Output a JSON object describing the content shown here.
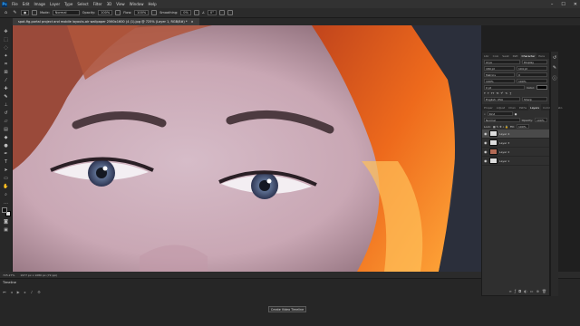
{
  "app": {
    "logo": "Ps"
  },
  "menu": [
    "File",
    "Edit",
    "Image",
    "Layer",
    "Type",
    "Select",
    "Filter",
    "3D",
    "View",
    "Window",
    "Help"
  ],
  "window_controls": [
    "–",
    "☐",
    "✕"
  ],
  "options_bar": {
    "mode_label": "Mode:",
    "mode_value": "Normal",
    "opacity_label": "Opacity:",
    "opacity_value": "100%",
    "flow_label": "Flow:",
    "flow_value": "100%",
    "smoothing_label": "Smoothing:",
    "smoothing_value": "0%",
    "angle_value": "0°"
  },
  "document_tab": {
    "title": "spot-fig-portal project and mobile layouts-air wallpaper 2560x1600 (4 (1).jpg @ 725% (Layer 1, RGB/8#) *",
    "close": "×"
  },
  "status_bar": {
    "zoom": "725.27%",
    "doc_info": "1977 px x 1080 px (72 ppi)"
  },
  "timeline": {
    "title": "Timeline",
    "create_button": "Create Video Timeline"
  },
  "character_panel": {
    "tabs": [
      "Libr",
      "Colo",
      "Swat",
      "Patt",
      "Character",
      "Para"
    ],
    "active_tab": "Character",
    "font_family": "Arya",
    "font_style": "Display",
    "size": "180 pt",
    "leading": "104 pt",
    "kerning": "Metrics",
    "tracking": "0",
    "vscale": "100%",
    "hscale": "100%",
    "baseline": "0 pt",
    "color_label": "Color:",
    "language": "English: USA",
    "antialias": "Sharp"
  },
  "layers_panel": {
    "tabs": [
      "Proper",
      "Adjust",
      "Chan",
      "Paths",
      "Layers",
      "Comm",
      "Histo"
    ],
    "active_tab": "Layers",
    "filter_label": "Kind",
    "blend_mode": "Normal",
    "opacity_label": "Opacity:",
    "opacity_value": "100%",
    "lock_label": "Lock:",
    "fill_label": "Fill:",
    "fill_value": "100%",
    "layers": [
      {
        "name": "Layer 4",
        "selected": true
      },
      {
        "name": "Layer 3",
        "selected": false
      },
      {
        "name": "Layer 2",
        "selected": false
      },
      {
        "name": "Layer 1",
        "selected": false
      }
    ]
  },
  "colors": {
    "accent": "#31a8ff",
    "hair": "#e3631e",
    "skin": "#c9a7b4"
  }
}
